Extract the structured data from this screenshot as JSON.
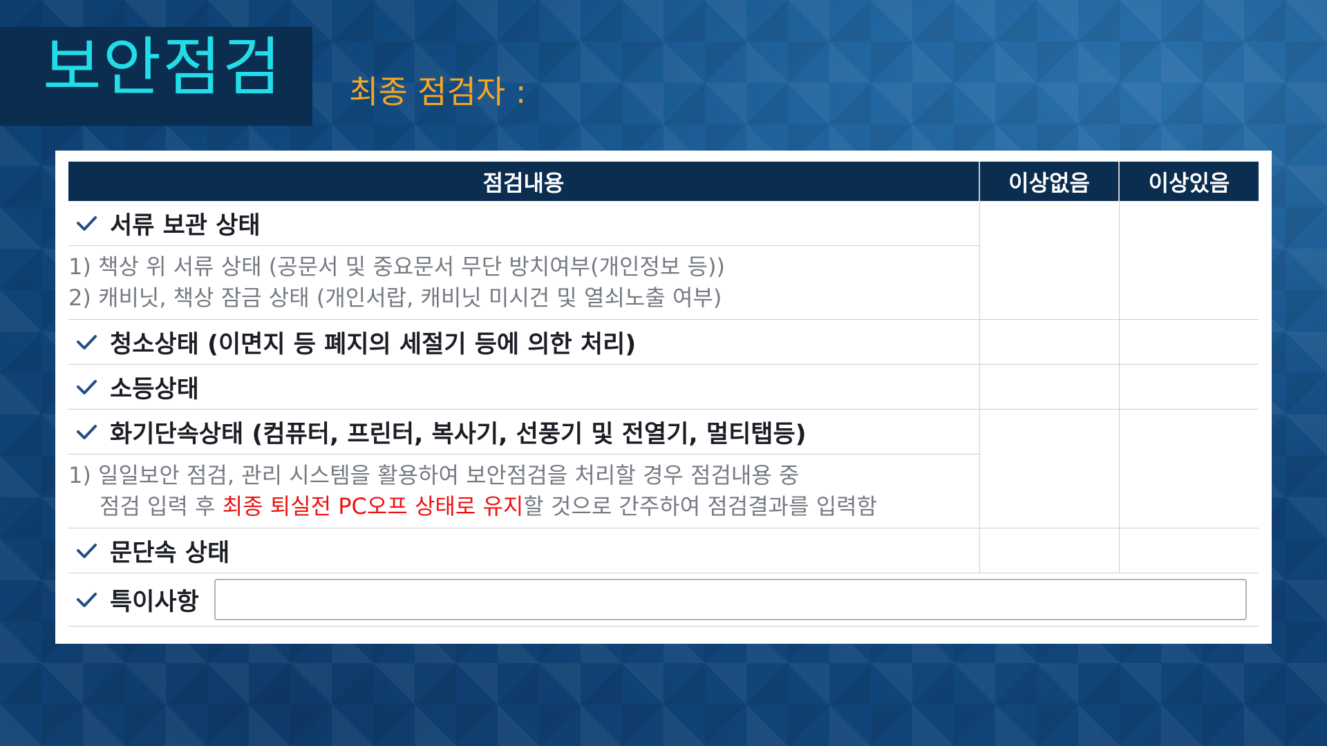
{
  "header": {
    "title": "보안점검",
    "inspector_label": "최종 점검자 :"
  },
  "colors": {
    "title_color": "#22dde8",
    "inspector_color": "#f5a623",
    "header_bg": "#0b2d50",
    "highlight_red": "#ee1111",
    "check_color": "#1f4f86"
  },
  "table": {
    "headers": [
      "점검내용",
      "이상없음",
      "이상있음"
    ],
    "sections": {
      "documents": {
        "label": "서류 보관 상태",
        "details": [
          "1) 책상 위 서류 상태 (공문서 및 중요문서 무단 방치여부(개인정보 등))",
          "2) 캐비닛, 책상 잠금 상태 (개인서랍, 캐비닛 미시건 및 열쇠노출 여부)"
        ]
      },
      "cleaning": {
        "label": "청소상태 (이면지 등 폐지의 세절기 등에 의한 처리)"
      },
      "lights": {
        "label": "소등상태"
      },
      "fire": {
        "label": "화기단속상태 (컴퓨터, 프린터, 복사기, 선풍기 및 전열기, 멀티탭등)",
        "detail_line1": "1) 일일보안 점검, 관리 시스템을 활용하여 보안점검을 처리할 경우 점검내용 중",
        "detail_line2_pre": "점검 입력 후 ",
        "detail_line2_red": "최종 퇴실전 PC오프 상태로 유지",
        "detail_line2_post": "할 것으로 간주하여 점검결과를 입력함"
      },
      "door": {
        "label": "문단속 상태"
      },
      "remarks": {
        "label": "특이사항",
        "value": "",
        "placeholder": ""
      }
    }
  },
  "icons": {
    "check": "checkmark-icon"
  }
}
